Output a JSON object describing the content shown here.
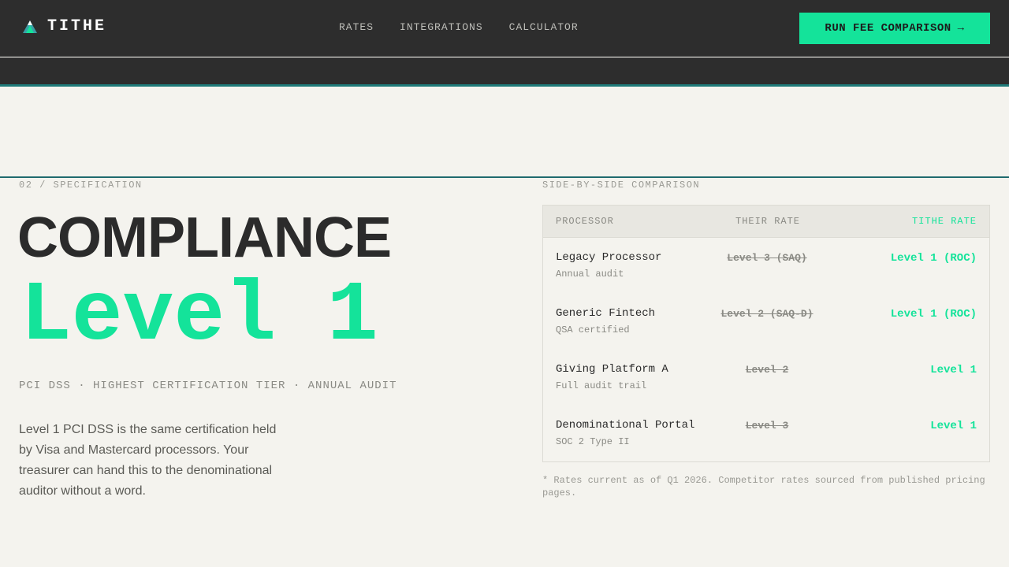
{
  "brand": {
    "name": "TITHE",
    "logo_icon": "mountain-logo-icon"
  },
  "nav": {
    "items": [
      {
        "label": "RATES"
      },
      {
        "label": "INTEGRATIONS"
      },
      {
        "label": "CALCULATOR"
      }
    ]
  },
  "cta": {
    "label": "RUN FEE COMPARISON",
    "arrow": "→"
  },
  "section": {
    "eyebrow": "02 / SPECIFICATION",
    "headline": "COMPLIANCE",
    "level": "Level 1",
    "meta": "PCI DSS · HIGHEST CERTIFICATION TIER · ANNUAL AUDIT",
    "description": "Level 1 PCI DSS is the same certification held by Visa and Mastercard processors. Your treasurer can hand this to the denominational auditor without a word."
  },
  "comparison": {
    "eyebrow": "SIDE-BY-SIDE COMPARISON",
    "headers": {
      "processor": "PROCESSOR",
      "their_rate": "THEIR RATE",
      "tithe_rate": "TITHE RATE"
    },
    "rows": [
      {
        "name": "Legacy Processor",
        "sub": "Annual audit",
        "theirs": "Level 3 (SAQ)",
        "tithe": "Level 1 (ROC)"
      },
      {
        "name": "Generic Fintech",
        "sub": "QSA certified",
        "theirs": "Level 2 (SAQ-D)",
        "tithe": "Level 1 (ROC)"
      },
      {
        "name": "Giving Platform A",
        "sub": "Full audit trail",
        "theirs": "Level 2",
        "tithe": "Level 1"
      },
      {
        "name": "Denominational Portal",
        "sub": "SOC 2 Type II",
        "theirs": "Level 3",
        "tithe": "Level 1"
      }
    ],
    "footnote": "* Rates current as of Q1 2026. Competitor rates sourced from published pricing pages."
  },
  "colors": {
    "accent": "#14e39a",
    "dark": "#2d2d2d",
    "teal_rule": "#1f6a6e",
    "background": "#f4f3ee"
  }
}
